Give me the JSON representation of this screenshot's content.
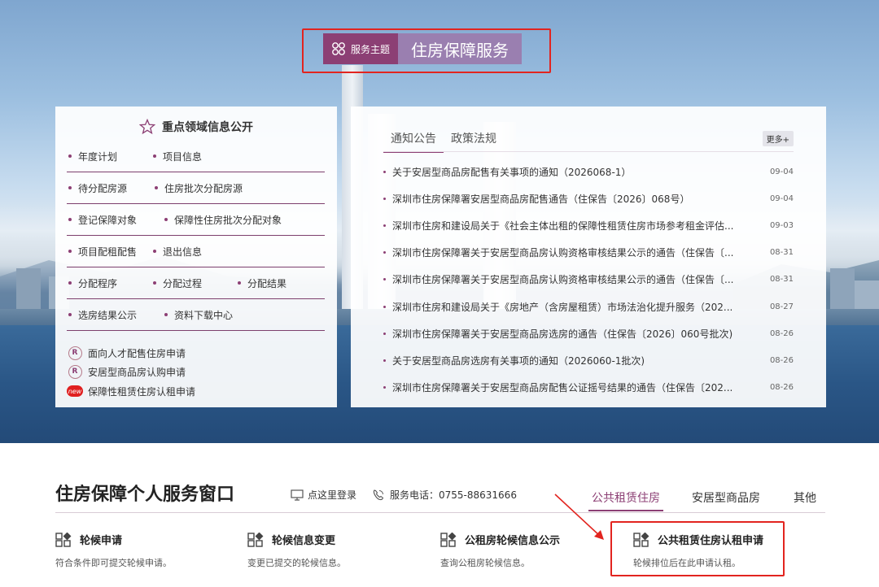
{
  "header": {
    "tag_label": "服务主题",
    "title": "住房保障服务"
  },
  "left_panel": {
    "title": "重点领域信息公开",
    "rows": [
      [
        "年度计划",
        "项目信息"
      ],
      [
        "待分配房源",
        "住房批次分配房源"
      ],
      [
        "登记保障对象",
        "保障性住房批次分配对象"
      ],
      [
        "项目配租配售",
        "退出信息"
      ],
      [
        "分配程序",
        "分配过程",
        "分配结果"
      ],
      [
        "选房结果公示",
        "资料下载中心"
      ]
    ],
    "applications": [
      {
        "label": "面向人才配售住房申请",
        "icon": "badge-icon"
      },
      {
        "label": "安居型商品房认购申请",
        "icon": "badge-icon"
      },
      {
        "label": "保障性租赁住房认租申请",
        "icon": "new-badge-icon",
        "badge": "new"
      }
    ]
  },
  "right_panel": {
    "tabs": [
      "通知公告",
      "政策法规"
    ],
    "active_tab": 0,
    "more_label": "更多+",
    "news": [
      {
        "title": "关于安居型商品房配售有关事项的通知（2026068-1）",
        "date": "09-04"
      },
      {
        "title": "深圳市住房保障署安居型商品房配售通告（住保告〔2026〕068号）",
        "date": "09-04"
      },
      {
        "title": "深圳市住房和建设局关于《社会主体出租的保障性租赁住房市场参考租金评估...",
        "date": "09-03"
      },
      {
        "title": "深圳市住房保障署关于安居型商品房认购资格审核结果公示的通告（住保告〔...",
        "date": "08-31"
      },
      {
        "title": "深圳市住房保障署关于安居型商品房认购资格审核结果公示的通告（住保告〔...",
        "date": "08-31"
      },
      {
        "title": "深圳市住房和建设局关于《房地产（含房屋租赁）市场法治化提升服务（202...",
        "date": "08-27"
      },
      {
        "title": "深圳市住房保障署关于安居型商品房选房的通告（住保告〔2026〕060号批次)",
        "date": "08-26"
      },
      {
        "title": "关于安居型商品房选房有关事项的通知（2026060-1批次)",
        "date": "08-26"
      },
      {
        "title": "深圳市住房保障署关于安居型商品房配售公证摇号结果的通告（住保告〔202...",
        "date": "08-26"
      }
    ]
  },
  "service": {
    "title": "住房保障个人服务窗口",
    "login_label": "点这里登录",
    "hotline_label": "服务电话：0755-88631666",
    "tabs": [
      "公共租赁住房",
      "安居型商品房",
      "其他"
    ],
    "active_tab": 0,
    "items": [
      {
        "name": "轮候申请",
        "desc": "符合条件即可提交轮候申请。"
      },
      {
        "name": "轮候信息变更",
        "desc": "变更已提交的轮候信息。"
      },
      {
        "name": "公租房轮候信息公示",
        "desc": "查询公租房轮候信息。"
      },
      {
        "name": "公共租赁住房认租申请",
        "desc": "轮候排位后在此申请认租。"
      }
    ]
  },
  "colors": {
    "accent": "#8c3f74",
    "title_bg": "#9a7fb0",
    "highlight": "#e2241f"
  }
}
